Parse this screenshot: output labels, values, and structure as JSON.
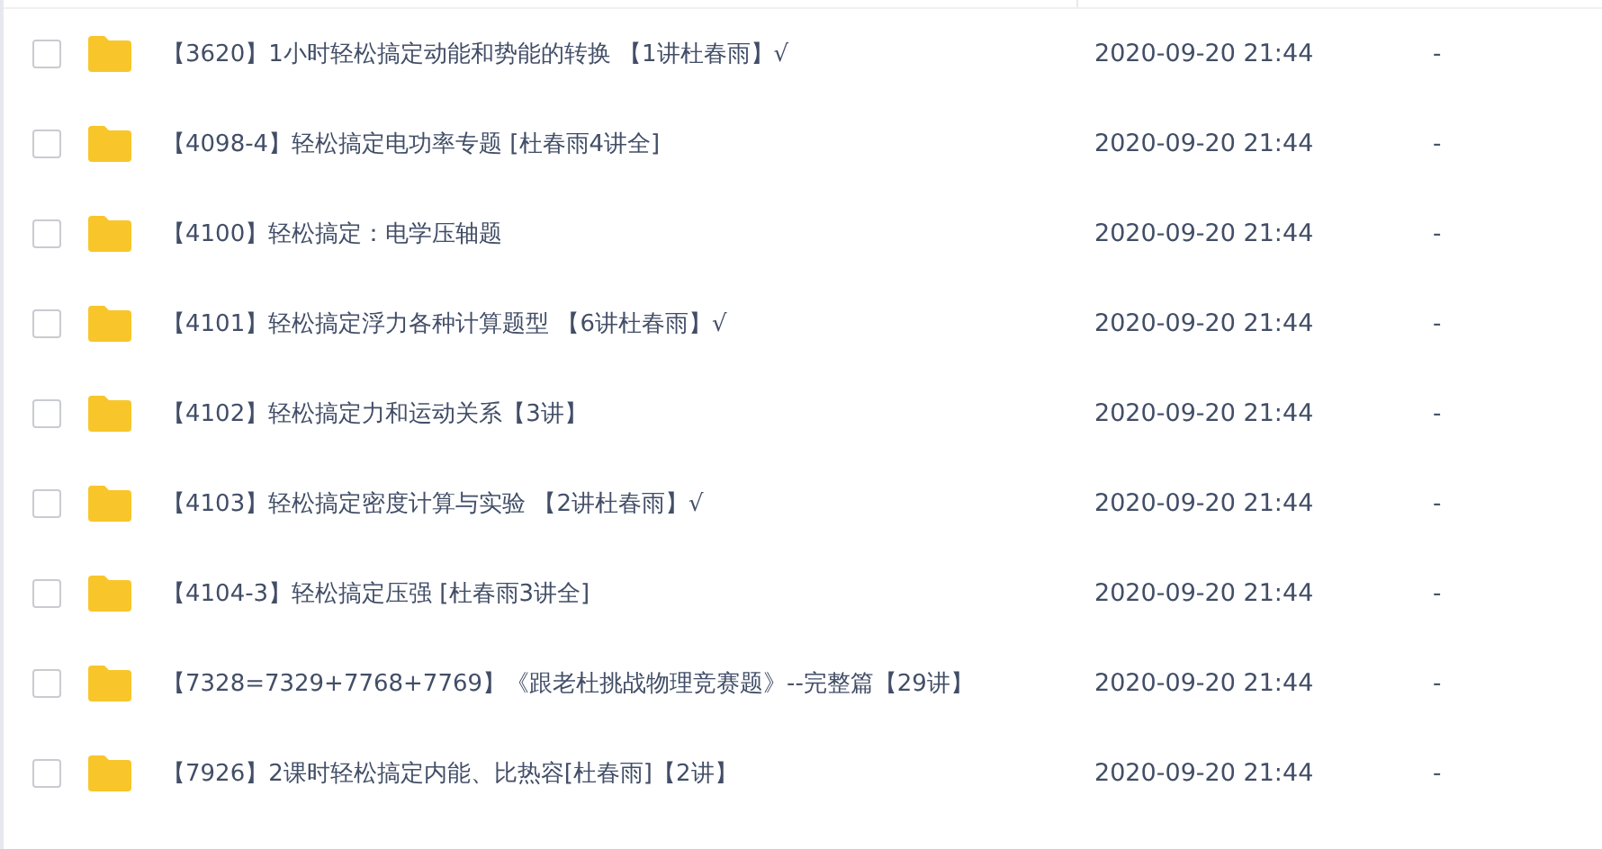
{
  "files": [
    {
      "name": "【3620】1小时轻松搞定动能和势能的转换 【1讲杜春雨】√",
      "modified": "2020-09-20 21:44",
      "size": "-",
      "checked": false
    },
    {
      "name": "【4098-4】轻松搞定电功率专题 [杜春雨4讲全]",
      "modified": "2020-09-20 21:44",
      "size": "-",
      "checked": false
    },
    {
      "name": "【4100】轻松搞定：电学压轴题",
      "modified": "2020-09-20 21:44",
      "size": "-",
      "checked": false
    },
    {
      "name": "【4101】轻松搞定浮力各种计算题型 【6讲杜春雨】√",
      "modified": "2020-09-20 21:44",
      "size": "-",
      "checked": false
    },
    {
      "name": "【4102】轻松搞定力和运动关系【3讲】",
      "modified": "2020-09-20 21:44",
      "size": "-",
      "checked": false
    },
    {
      "name": "【4103】轻松搞定密度计算与实验 【2讲杜春雨】√",
      "modified": "2020-09-20 21:44",
      "size": "-",
      "checked": false
    },
    {
      "name": "【4104-3】轻松搞定压强 [杜春雨3讲全]",
      "modified": "2020-09-20 21:44",
      "size": "-",
      "checked": false
    },
    {
      "name": "【7328=7329+7768+7769】《跟老杜挑战物理竞赛题》--完整篇【29讲】",
      "modified": "2020-09-20 21:44",
      "size": "-",
      "checked": false
    },
    {
      "name": "【7926】2课时轻松搞定内能、比热容[杜春雨]【2讲】",
      "modified": "2020-09-20 21:44",
      "size": "-",
      "checked": false
    }
  ]
}
